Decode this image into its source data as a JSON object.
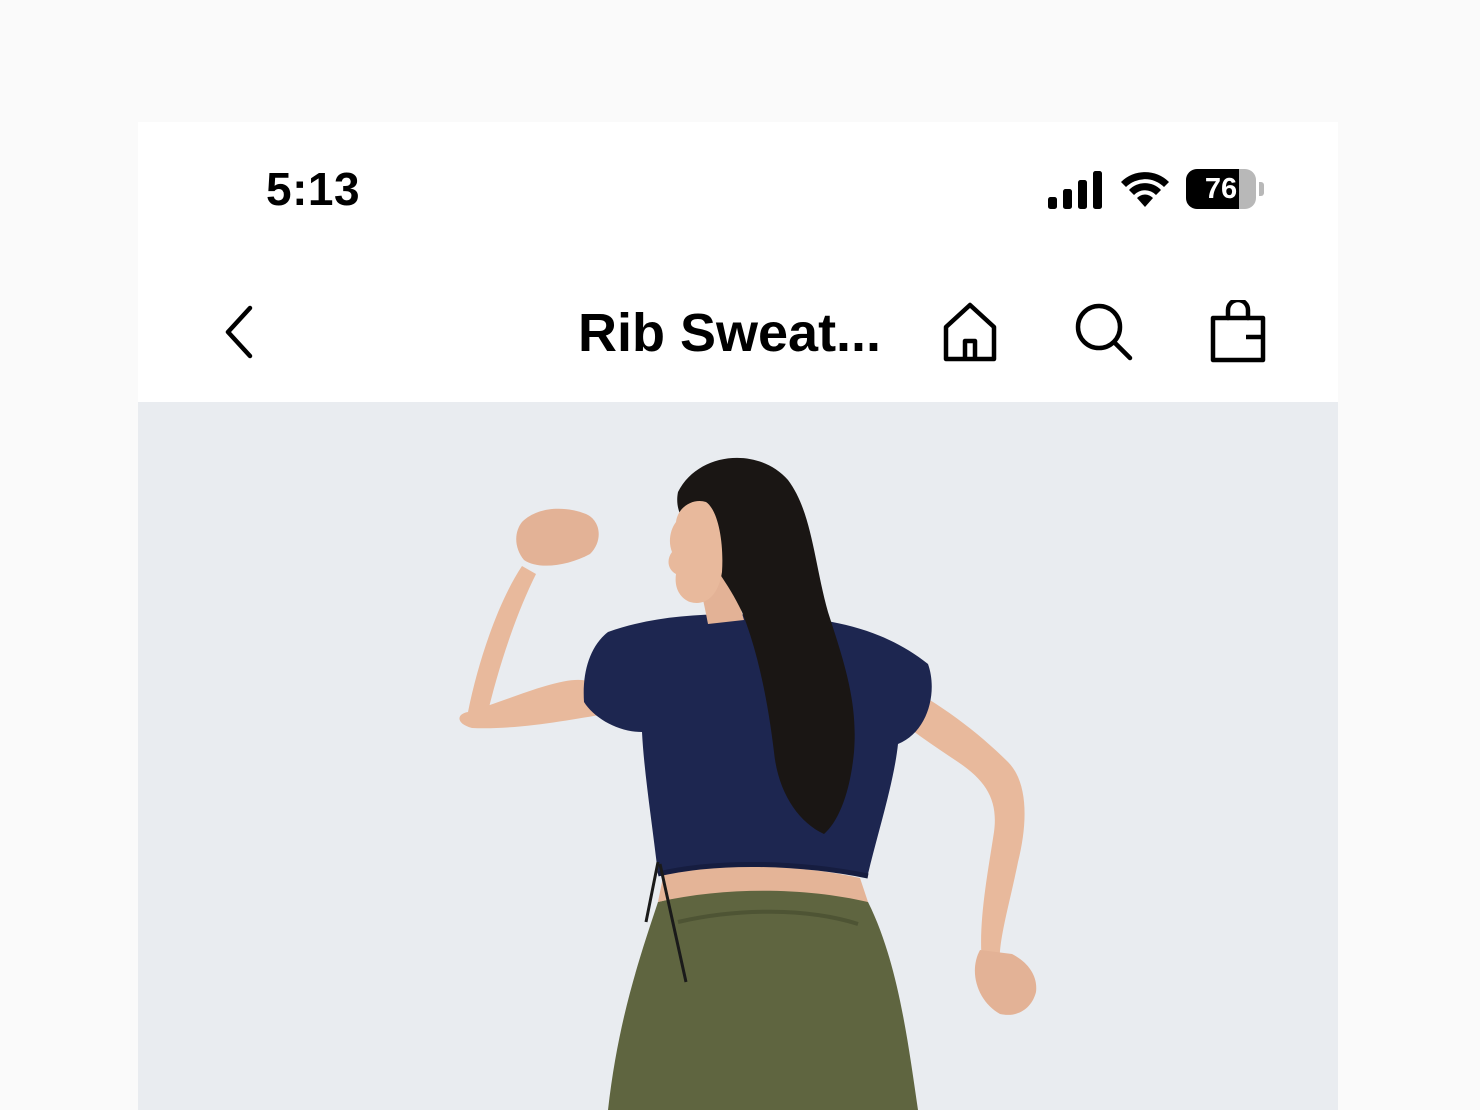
{
  "status_bar": {
    "time": "5:13",
    "battery_level": "76",
    "icons": [
      "cellular-signal-icon",
      "wifi-icon",
      "battery-icon"
    ]
  },
  "nav": {
    "title": "Rib Sweat...",
    "icons": [
      "back-chevron-icon",
      "home-icon",
      "search-icon",
      "shopping-bag-icon"
    ]
  },
  "hero": {
    "alt": "Model wearing navy cropped tee and olive sweatpants"
  },
  "colors": {
    "background": "#fafafa",
    "hero_background": "#e9ecf0",
    "shirt": "#1d2650",
    "pants": "#5f6540",
    "hair": "#1a1614",
    "skin": "#e8b99c"
  }
}
